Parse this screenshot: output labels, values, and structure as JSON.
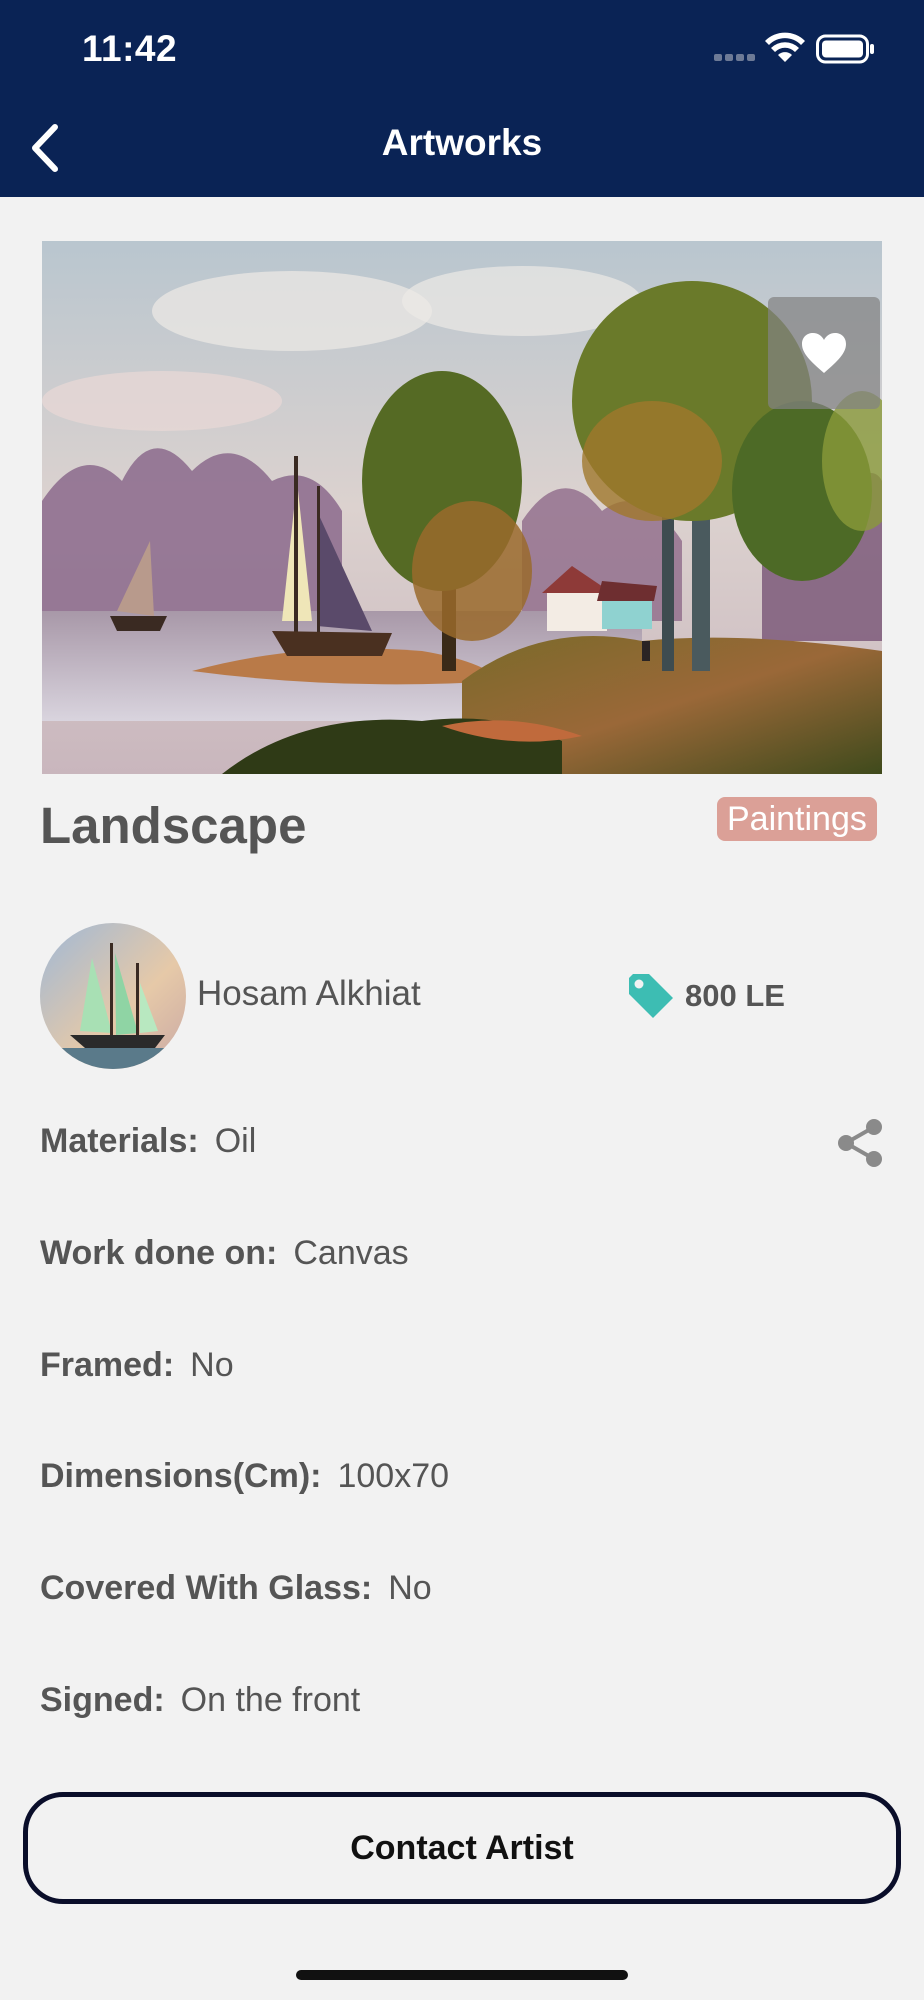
{
  "status_bar": {
    "time": "11:42"
  },
  "header": {
    "title": "Artworks",
    "back_icon": "chevron-left-icon"
  },
  "artwork": {
    "title": "Landscape",
    "category": "Paintings",
    "favorite_icon": "heart-icon"
  },
  "artist": {
    "name": "Hosam Alkhiat",
    "price": "800 LE",
    "price_icon": "tag-icon"
  },
  "details": [
    {
      "label": "Materials:",
      "value": "Oil"
    },
    {
      "label": "Work done on:",
      "value": "Canvas"
    },
    {
      "label": "Framed:",
      "value": "No"
    },
    {
      "label": "Dimensions(Cm):",
      "value": "100x70"
    },
    {
      "label": "Covered With Glass:",
      "value": "No"
    },
    {
      "label": "Signed:",
      "value": "On the front"
    }
  ],
  "share_icon": "share-icon",
  "contact_button": {
    "label": "Contact Artist"
  },
  "colors": {
    "header_bg": "#0a2355",
    "category_badge": "#dba097",
    "price_tag": "#3dbdb3",
    "page_bg": "#f2f2f2"
  }
}
